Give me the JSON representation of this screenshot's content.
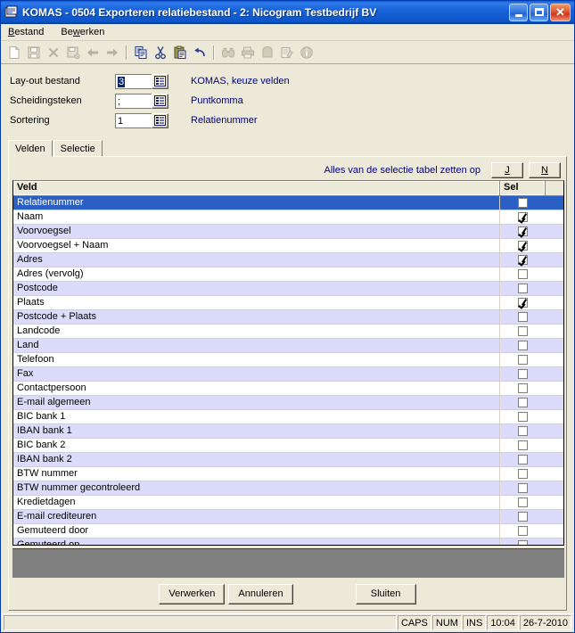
{
  "window": {
    "title": "KOMAS - 0504 Exporteren relatiebestand - 2: Nicogram Testbedrijf BV",
    "icon": "app-icon",
    "minimize_label": "",
    "maximize_label": "",
    "close_label": "✕"
  },
  "menu": {
    "items": [
      {
        "label": "Bestand",
        "accel": "B"
      },
      {
        "label": "Bewerken",
        "accel": "w"
      }
    ]
  },
  "toolbar": {
    "buttons": [
      {
        "name": "new-icon",
        "enabled": false
      },
      {
        "name": "save-icon",
        "enabled": false
      },
      {
        "name": "delete-icon",
        "enabled": false
      },
      {
        "name": "save-as-icon",
        "enabled": false
      },
      {
        "name": "previous-icon",
        "enabled": false
      },
      {
        "name": "next-icon",
        "enabled": false
      },
      {
        "name": "copy-icon",
        "enabled": true
      },
      {
        "name": "cut-icon",
        "enabled": true
      },
      {
        "name": "paste-icon",
        "enabled": true
      },
      {
        "name": "undo-icon",
        "enabled": true
      },
      {
        "name": "find-icon",
        "enabled": false
      },
      {
        "name": "print-icon",
        "enabled": false
      },
      {
        "name": "print-preview-icon",
        "enabled": false
      },
      {
        "name": "edit-icon",
        "enabled": false
      },
      {
        "name": "info-icon",
        "enabled": false
      }
    ]
  },
  "form": {
    "rows": [
      {
        "label": "Lay-out bestand",
        "value": "3",
        "description": "KOMAS, keuze velden",
        "selected": true
      },
      {
        "label": "Scheidingsteken",
        "value": ";",
        "description": "Puntkomma",
        "selected": false
      },
      {
        "label": "Sortering",
        "value": "1",
        "description": "Relatienummer",
        "selected": false
      }
    ]
  },
  "tabs": {
    "items": [
      {
        "label": "Velden",
        "active": true
      },
      {
        "label": "Selectie",
        "active": false
      }
    ]
  },
  "setall": {
    "label": "Alles van de selectie tabel zetten op",
    "yes_label": "J",
    "no_label": "N"
  },
  "grid": {
    "columns": [
      "Veld",
      "Sel"
    ],
    "rows": [
      {
        "veld": "Relatienummer",
        "sel": false,
        "selected": true
      },
      {
        "veld": "Naam",
        "sel": true,
        "selected": false
      },
      {
        "veld": "Voorvoegsel",
        "sel": true,
        "selected": false
      },
      {
        "veld": "Voorvoegsel + Naam",
        "sel": true,
        "selected": false
      },
      {
        "veld": "Adres",
        "sel": true,
        "selected": false
      },
      {
        "veld": "Adres (vervolg)",
        "sel": false,
        "selected": false
      },
      {
        "veld": "Postcode",
        "sel": false,
        "selected": false
      },
      {
        "veld": "Plaats",
        "sel": true,
        "selected": false
      },
      {
        "veld": "Postcode + Plaats",
        "sel": false,
        "selected": false
      },
      {
        "veld": "Landcode",
        "sel": false,
        "selected": false
      },
      {
        "veld": "Land",
        "sel": false,
        "selected": false
      },
      {
        "veld": "Telefoon",
        "sel": false,
        "selected": false
      },
      {
        "veld": "Fax",
        "sel": false,
        "selected": false
      },
      {
        "veld": "Contactpersoon",
        "sel": false,
        "selected": false
      },
      {
        "veld": "E-mail algemeen",
        "sel": false,
        "selected": false
      },
      {
        "veld": "BIC bank 1",
        "sel": false,
        "selected": false
      },
      {
        "veld": "IBAN bank 1",
        "sel": false,
        "selected": false
      },
      {
        "veld": "BIC bank 2",
        "sel": false,
        "selected": false
      },
      {
        "veld": "IBAN bank 2",
        "sel": false,
        "selected": false
      },
      {
        "veld": "BTW nummer",
        "sel": false,
        "selected": false
      },
      {
        "veld": "BTW nummer gecontroleerd",
        "sel": false,
        "selected": false
      },
      {
        "veld": "Kredietdagen",
        "sel": false,
        "selected": false
      },
      {
        "veld": "E-mail crediteuren",
        "sel": false,
        "selected": false
      },
      {
        "veld": "Gemuteerd door",
        "sel": false,
        "selected": false
      },
      {
        "veld": "Gemuteerd op",
        "sel": false,
        "selected": false
      }
    ]
  },
  "buttons": {
    "process": {
      "label": "Verwerken",
      "accel": "w"
    },
    "cancel": {
      "label": "Annuleren",
      "accel": "A"
    },
    "close": {
      "label": "Sluiten",
      "accel": "l"
    }
  },
  "statusbar": {
    "message": "",
    "caps": "CAPS",
    "num": "NUM",
    "ins": "INS",
    "time": "10:04",
    "date": "26-7-2010"
  }
}
